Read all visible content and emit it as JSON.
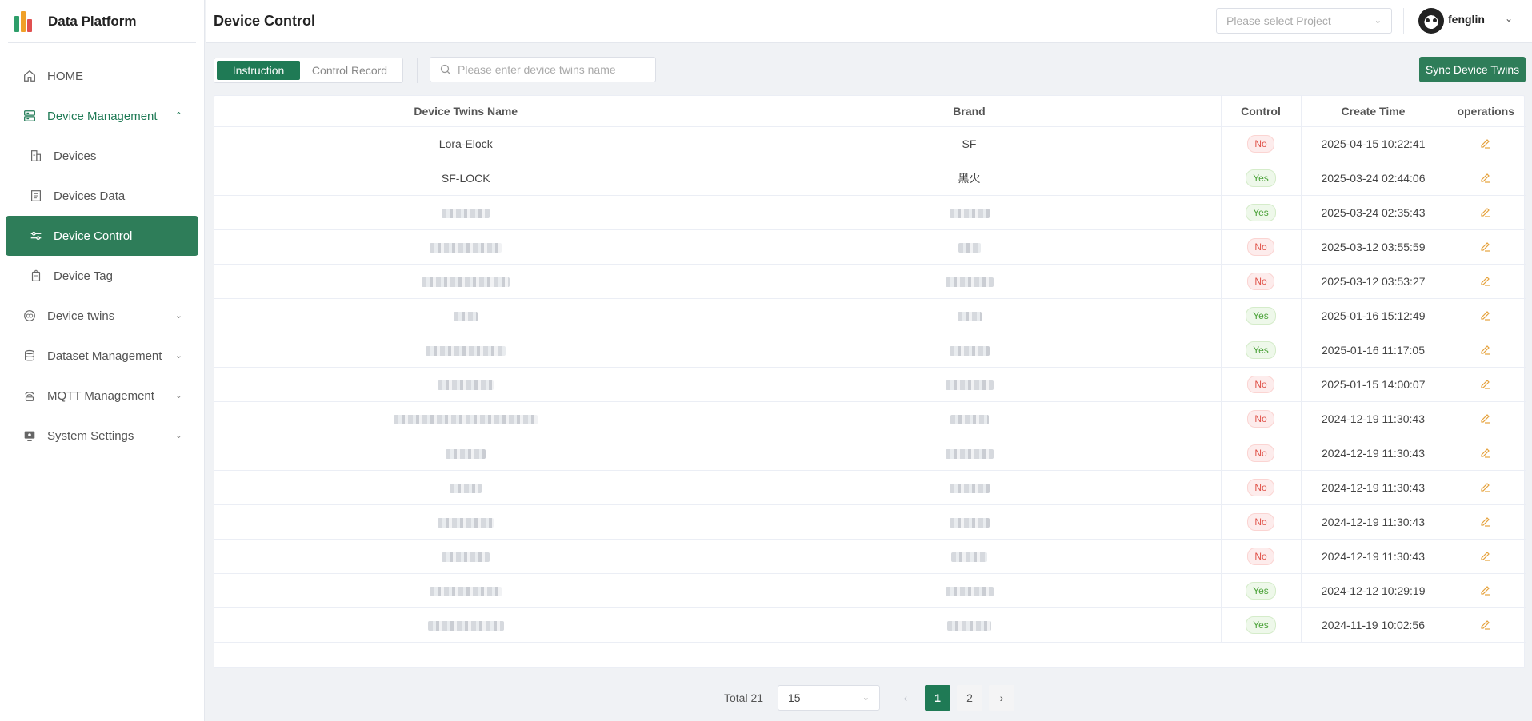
{
  "app": {
    "title": "Data Platform"
  },
  "sidebar": {
    "items": [
      {
        "label": "HOME",
        "icon": "home-icon"
      },
      {
        "label": "Device Management",
        "icon": "server-icon",
        "open": true
      },
      {
        "label": "Devices",
        "icon": "devices-icon",
        "sub": true
      },
      {
        "label": "Devices Data",
        "icon": "data-icon",
        "sub": true
      },
      {
        "label": "Device Control",
        "icon": "sliders-icon",
        "sub": true,
        "active": true
      },
      {
        "label": "Device Tag",
        "icon": "tag-icon",
        "sub": true
      },
      {
        "label": "Device twins",
        "icon": "twins-icon"
      },
      {
        "label": "Dataset Management",
        "icon": "database-icon"
      },
      {
        "label": "MQTT Management",
        "icon": "mqtt-icon"
      },
      {
        "label": "System Settings",
        "icon": "monitor-icon"
      }
    ]
  },
  "header": {
    "title": "Device Control",
    "project_placeholder": "Please select Project",
    "username": "fenglin"
  },
  "toolbar": {
    "tabs": [
      "Instruction",
      "Control Record"
    ],
    "search_placeholder": "Please enter device twins name",
    "sync_label": "Sync Device Twins"
  },
  "table": {
    "columns": [
      "Device Twins Name",
      "Brand",
      "Control",
      "Create Time",
      "operations"
    ],
    "rows": [
      {
        "name": "Lora-Elock",
        "brand": "SF",
        "control": "No",
        "time": "2025-04-15 10:22:41"
      },
      {
        "name": "SF-LOCK",
        "brand": "黑火",
        "control": "Yes",
        "time": "2025-03-24 02:44:06"
      },
      {
        "name": "",
        "brand": "",
        "control": "Yes",
        "time": "2025-03-24 02:35:43"
      },
      {
        "name": "",
        "brand": "",
        "control": "No",
        "time": "2025-03-12 03:55:59"
      },
      {
        "name": "",
        "brand": "",
        "control": "No",
        "time": "2025-03-12 03:53:27"
      },
      {
        "name": "",
        "brand": "",
        "control": "Yes",
        "time": "2025-01-16 15:12:49"
      },
      {
        "name": "",
        "brand": "",
        "control": "Yes",
        "time": "2025-01-16 11:17:05"
      },
      {
        "name": "",
        "brand": "",
        "control": "No",
        "time": "2025-01-15 14:00:07"
      },
      {
        "name": "",
        "brand": "",
        "control": "No",
        "time": "2024-12-19 11:30:43"
      },
      {
        "name": "",
        "brand": "",
        "control": "No",
        "time": "2024-12-19 11:30:43"
      },
      {
        "name": "",
        "brand": "",
        "control": "No",
        "time": "2024-12-19 11:30:43"
      },
      {
        "name": "",
        "brand": "",
        "control": "No",
        "time": "2024-12-19 11:30:43"
      },
      {
        "name": "",
        "brand": "",
        "control": "No",
        "time": "2024-12-19 11:30:43"
      },
      {
        "name": "",
        "brand": "",
        "control": "Yes",
        "time": "2024-12-12 10:29:19"
      },
      {
        "name": "",
        "brand": "",
        "control": "Yes",
        "time": "2024-11-19 10:02:56"
      }
    ]
  },
  "pagination": {
    "total_label": "Total 21",
    "page_size": "15",
    "pages": [
      "1",
      "2"
    ],
    "current": "1"
  },
  "colors": {
    "accent": "#2e7d59",
    "no": "#e0534a",
    "yes": "#4ca33a",
    "edit": "#e6a23c"
  }
}
